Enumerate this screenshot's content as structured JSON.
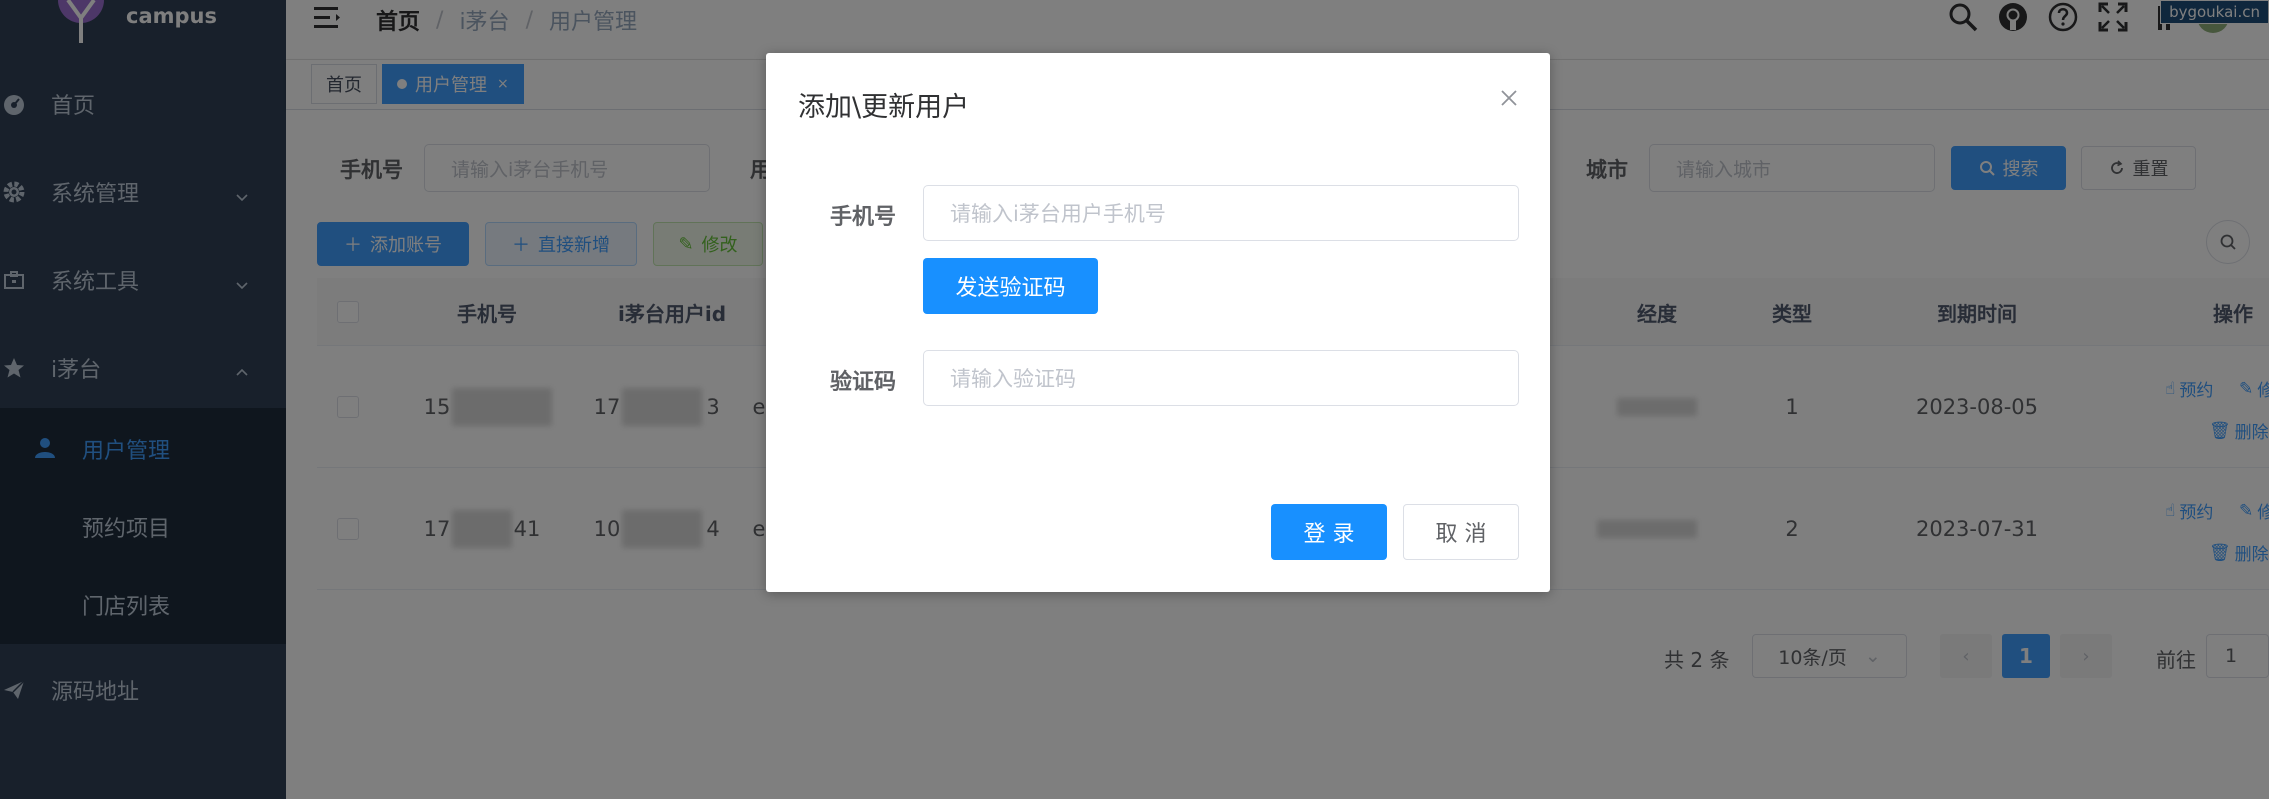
{
  "sidebar": {
    "brand": "campus",
    "items": [
      {
        "label": "首页",
        "icon": "dashboard-icon"
      },
      {
        "label": "系统管理",
        "icon": "gear-icon"
      },
      {
        "label": "系统工具",
        "icon": "toolbox-icon"
      },
      {
        "label": "i茅台",
        "icon": "star-icon"
      }
    ],
    "subitems": [
      {
        "label": "用户管理",
        "icon": "user-icon",
        "active": true
      },
      {
        "label": "预约项目"
      },
      {
        "label": "门店列表"
      }
    ],
    "source": {
      "label": "源码地址",
      "icon": "paper-plane-icon"
    }
  },
  "navbar": {
    "breadcrumbs": [
      "首页",
      "i茅台",
      "用户管理"
    ],
    "separator": "/",
    "watermark": "bygoukai.cn"
  },
  "tags": [
    {
      "label": "首页",
      "active": false
    },
    {
      "label": "用户管理",
      "active": true,
      "close": "×"
    }
  ],
  "search": {
    "phone_label": "手机号",
    "phone_placeholder": "请输入i茅台手机号",
    "partial_label": "用",
    "city_label": "城市",
    "city_placeholder": "请输入城市",
    "search_btn": "搜索",
    "reset_btn": "重置"
  },
  "toolbar": {
    "add_account": "添加账号",
    "direct_add": "直接新增",
    "edit": "修改"
  },
  "table": {
    "headers": {
      "phone": "手机号",
      "uid": "i茅台用户id",
      "lng": "经度",
      "type": "类型",
      "expire": "到期时间",
      "ops": "操作"
    },
    "rows": [
      {
        "phone_start": "15",
        "uid_start": "17",
        "uid_end": "3",
        "col_e": "e",
        "type": "1",
        "expire": "2023-08-05"
      },
      {
        "phone_start": "17",
        "phone_end": "41",
        "uid_start": "10",
        "uid_end": "4",
        "col_e": "e",
        "type": "2",
        "expire": "2023-07-31"
      }
    ],
    "op_reserve": "预约",
    "op_edit": "修",
    "op_delete": "删除"
  },
  "pagination": {
    "total": "共 2 条",
    "page_size": "10条/页",
    "current": "1",
    "goto_label": "前往",
    "goto_value": "1"
  },
  "dialog": {
    "title": "添加\\更新用户",
    "phone_label": "手机号",
    "phone_placeholder": "请输入i茅台用户手机号",
    "send_code": "发送验证码",
    "code_label": "验证码",
    "code_placeholder": "请输入验证码",
    "login": "登 录",
    "cancel": "取 消"
  }
}
